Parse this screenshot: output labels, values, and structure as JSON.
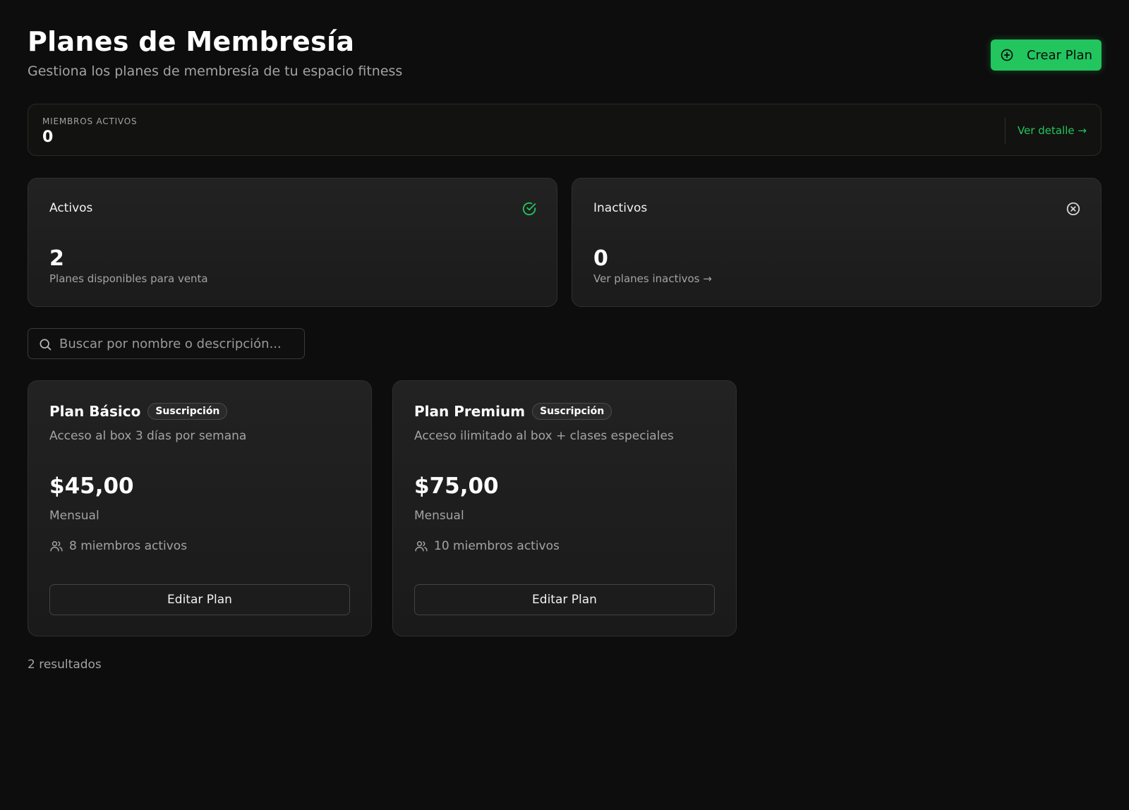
{
  "header": {
    "title": "Planes de Membresía",
    "subtitle": "Gestiona los planes de membresía de tu espacio fitness",
    "create_button": "Crear Plan"
  },
  "members_summary": {
    "label": "MIEMBROS ACTIVOS",
    "value": "0",
    "link": "Ver detalle →"
  },
  "stats": {
    "active": {
      "title": "Activos",
      "value": "2",
      "description": "Planes disponibles para venta",
      "icon": "check-circle-icon",
      "icon_color": "#22c55e"
    },
    "inactive": {
      "title": "Inactivos",
      "value": "0",
      "description": "Ver planes inactivos →",
      "icon": "x-circle-icon",
      "icon_color": "#d4d4d4"
    }
  },
  "search": {
    "placeholder": "Buscar por nombre o descripción...",
    "value": ""
  },
  "plans": [
    {
      "name": "Plan Básico",
      "badge": "Suscripción",
      "description": "Acceso al box 3 días por semana",
      "price": "$45,00",
      "period": "Mensual",
      "members": "8 miembros activos",
      "edit_label": "Editar Plan"
    },
    {
      "name": "Plan Premium",
      "badge": "Suscripción",
      "description": "Acceso ilimitado al box + clases especiales",
      "price": "$75,00",
      "period": "Mensual",
      "members": "10 miembros activos",
      "edit_label": "Editar Plan"
    }
  ],
  "results_count": "2 resultados",
  "colors": {
    "accent": "#22c55e",
    "background": "#0d0d0d",
    "card": "#1f1f1f",
    "muted_text": "#a3a3a3"
  }
}
